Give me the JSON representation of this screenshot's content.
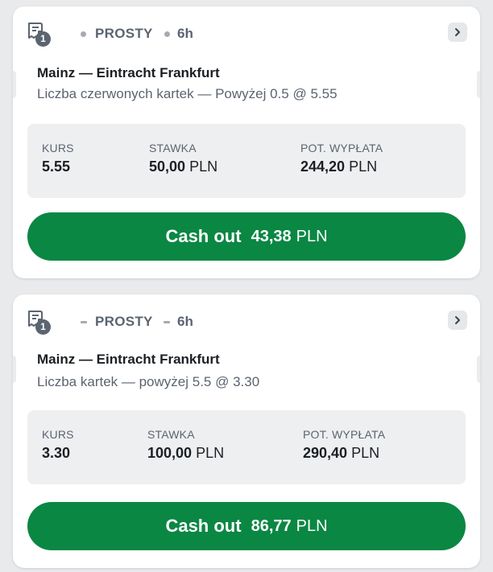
{
  "bets": [
    {
      "badge_count": "1",
      "type": "PROSTY",
      "age": "6h",
      "event": "Mainz — Eintracht Frankfurt",
      "market": "Liczba czerwonych kartek — Powyżej 0.5 @ 5.55",
      "odds_label": "KURS",
      "odds": "5.55",
      "stake_label": "STAWKA",
      "stake": "50,00",
      "stake_currency": "PLN",
      "payout_label": "POT. WYPŁATA",
      "payout": "244,20",
      "payout_currency": "PLN",
      "cashout_label": "Cash out",
      "cashout_amount": "43,38",
      "cashout_currency": "PLN"
    },
    {
      "badge_count": "1",
      "type": "PROSTY",
      "age": "6h",
      "event": "Mainz — Eintracht Frankfurt",
      "market": "Liczba kartek — powyżej 5.5 @ 3.30",
      "odds_label": "KURS",
      "odds": "3.30",
      "stake_label": "STAWKA",
      "stake": "100,00",
      "stake_currency": "PLN",
      "payout_label": "POT. WYPŁATA",
      "payout": "290,40",
      "payout_currency": "PLN",
      "cashout_label": "Cash out",
      "cashout_amount": "86,77",
      "cashout_currency": "PLN"
    }
  ],
  "icons": {
    "ticket": "bet-ticket-icon",
    "open": "chevron-right-icon"
  },
  "colors": {
    "cashout_button": "#0a8743",
    "muted_text": "#5b6470",
    "stats_panel": "#eeeff1"
  }
}
